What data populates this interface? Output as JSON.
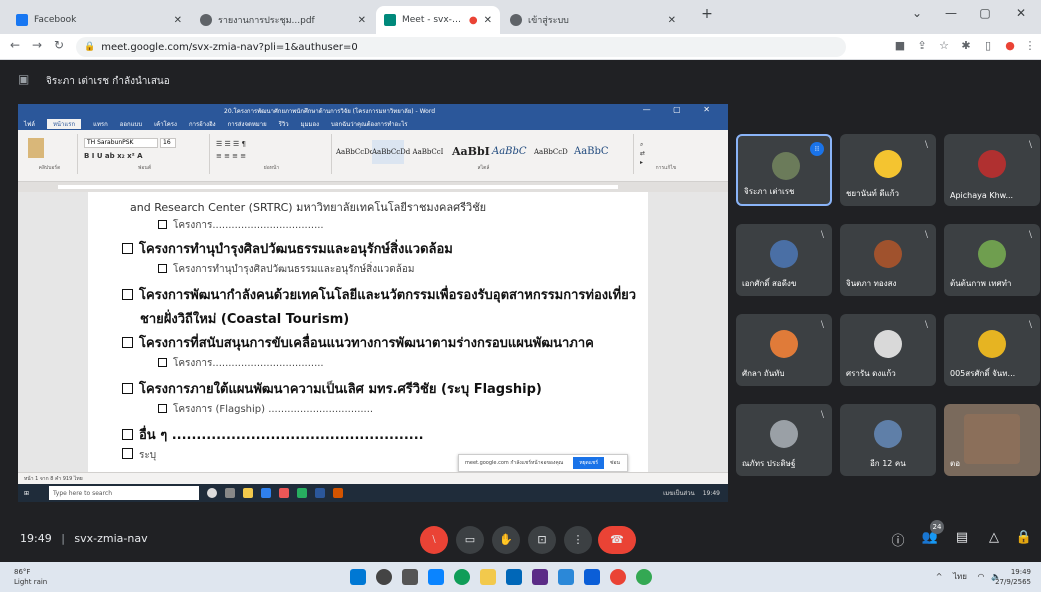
{
  "browser": {
    "tabs": [
      {
        "label": "Facebook",
        "active": false
      },
      {
        "label": "รายงานการประชุม...pdf",
        "active": false
      },
      {
        "label": "Meet - svx-zmia-nav",
        "active": true
      },
      {
        "label": "เข้าสู่ระบบ",
        "active": false
      }
    ],
    "url": "meet.google.com/svx-zmia-nav?pli=1&authuser=0",
    "new_tab": "+"
  },
  "meet": {
    "presenter_label": "จิระภา เต่าเรช กำลังนำเสนอ",
    "time": "19:49",
    "meeting_code": "svx-zmia-nav",
    "participant_count_badge": "24",
    "participants": [
      {
        "name": "จิระภา เต่าเรช",
        "speaking": true,
        "muted": false,
        "avatar_color": "#6b7b5a"
      },
      {
        "name": "ชยานันท์ ดีแก้ว",
        "speaking": false,
        "muted": true,
        "avatar_color": "#f4c430"
      },
      {
        "name": "Apichaya Khw...",
        "speaking": false,
        "muted": true,
        "avatar_color": "#b03030"
      },
      {
        "name": "เอกศักดิ์ สอดีงข",
        "speaking": false,
        "muted": true,
        "avatar_color": "#4a6fa5"
      },
      {
        "name": "จินตภา ทองสง",
        "speaking": false,
        "muted": true,
        "avatar_color": "#a0522d"
      },
      {
        "name": "ต้นต้นกาพ เทศทำ",
        "speaking": false,
        "muted": true,
        "avatar_color": "#6f9e4f"
      },
      {
        "name": "ศักลา ถันทับ",
        "speaking": false,
        "muted": true,
        "avatar_color": "#e07b39"
      },
      {
        "name": "ศรารัน ดงแก้ว",
        "speaking": false,
        "muted": true,
        "avatar_color": "#d9d9d9"
      },
      {
        "name": "005สรศักดิ์ จันท...",
        "speaking": false,
        "muted": true,
        "avatar_color": "#e6b422"
      },
      {
        "name": "ณภัทร ประดิษฐ์",
        "speaking": false,
        "muted": true,
        "avatar_color": "#9aa0a6"
      },
      {
        "name": "อีก 12 คน",
        "speaking": false,
        "muted": false,
        "avatar_color": "#5f7fa8"
      },
      {
        "name": "ตอ",
        "speaking": false,
        "muted": false,
        "avatar_color": "#8b6f5a"
      }
    ]
  },
  "word": {
    "title": "20.โครงการพัฒนาศักยภาพนักศึกษาด้านการวิจัย (โครงการมหาวิทยาลัย) - Word",
    "menu": [
      "ไฟล์",
      "หน้าแรก",
      "แทรก",
      "ออกแบบ",
      "เค้าโครง",
      "การอ้างอิง",
      "การส่งจดหมาย",
      "รีวิว",
      "มุมมอง",
      "บอกฉันว่าคุณต้องการทำอะไร"
    ],
    "active_menu": "หน้าแรก",
    "font_name": "TH SarabunPSK",
    "font_size": "16",
    "styles": [
      "AaBbCcDd",
      "AaBbCcDd",
      "AaBbCcI",
      "AaBbI",
      "AaBbC",
      "AaBbCcD",
      "AaBbC"
    ],
    "ribbon_groups": [
      "คลิปบอร์ด",
      "ฟอนต์",
      "ย่อหน้า",
      "สไตล์",
      "การแก้ไข"
    ],
    "doc_lines": [
      {
        "text": "and Research Center (SRTRC) มหาวิทยาลัยเทคโนโลยีราชมงคลศรีวิชัย",
        "level": 2,
        "box": false
      },
      {
        "text": "โครงการ...................................",
        "level": 2,
        "box": true
      },
      {
        "text": "โครงการทำนุบำรุงศิลปวัฒนธรรมและอนุรักษ์สิ่งแวดล้อม",
        "level": 1,
        "box": true
      },
      {
        "text": "โครงการทำนุบำรุงศิลปวัฒนธรรมและอนุรักษ์สิ่งแวดล้อม",
        "level": 2,
        "box": true
      },
      {
        "text": "โครงการพัฒนากำลังคนด้วยเทคโนโลยีและนวัตกรรมเพื่อรองรับอุตสาหกรรมการท่องเที่ยว",
        "level": 1,
        "box": true
      },
      {
        "text": "ชายฝั่งวิถีใหม่ (Coastal Tourism)",
        "level": 1,
        "box": false
      },
      {
        "text": "โครงการที่สนับสนุนการขับเคลื่อนแนวทางการพัฒนาตามร่างกรอบแผนพัฒนาภาค",
        "level": 1,
        "box": true
      },
      {
        "text": "โครงการ...................................",
        "level": 2,
        "box": true
      },
      {
        "text": "โครงการภายใต้แผนพัฒนาความเป็นเลิศ มทร.ศรีวิชัย (ระบุ Flagship)",
        "level": 1,
        "box": true
      },
      {
        "text": "โครงการ (Flagship) .................................",
        "level": 2,
        "box": true
      },
      {
        "text": "อื่น ๆ ...................................................",
        "level": 1,
        "box": true
      },
      {
        "text": "ระบุ",
        "level": 1,
        "box": true
      }
    ],
    "status": "หน้า 1 จาก 8   คำ 919   ไทย",
    "notification": "meet.google.com กำลังแชร์หน้าจอของคุณ",
    "notification_button": "หยุดแชร์",
    "notification_hide": "ซ่อน"
  },
  "inner_taskbar": {
    "search_placeholder": "Type here to search",
    "tray": "เมฆเป็นส่วน",
    "clock": "19:49"
  },
  "os_taskbar": {
    "weather_temp": "86°F",
    "weather_desc": "Light rain",
    "clock_time": "19:49",
    "clock_date": "27/9/2565",
    "lang": "ไทย"
  },
  "colors": {
    "meet_bg": "#202124",
    "tile_bg": "#3c4043",
    "word_blue": "#2b579a",
    "end_call_red": "#ea4335",
    "speaking_border": "#8ab4f8"
  }
}
